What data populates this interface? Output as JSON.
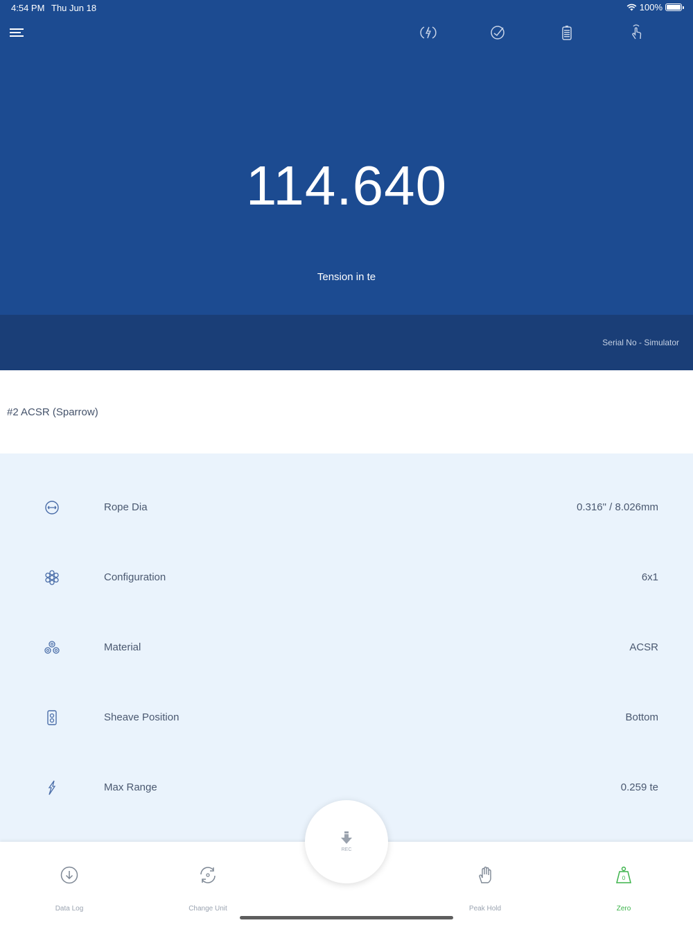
{
  "status_bar": {
    "time": "4:54 PM",
    "date": "Thu Jun 18",
    "battery": "100%"
  },
  "toolbar": {
    "icons": [
      "menu-icon",
      "power-icon",
      "calibration-icon",
      "battery-icon",
      "touch-icon"
    ]
  },
  "reading": {
    "value": "114.640",
    "label": "Tension in te"
  },
  "device": {
    "serial": "Serial No - Simulator"
  },
  "product": {
    "name": "#2 ACSR (Sparrow)"
  },
  "details": [
    {
      "icon": "rope-dia-icon",
      "label": "Rope Dia",
      "value": "0.316\" / 8.026mm"
    },
    {
      "icon": "configuration-icon",
      "label": "Configuration",
      "value": "6x1"
    },
    {
      "icon": "material-icon",
      "label": "Material",
      "value": "ACSR"
    },
    {
      "icon": "sheave-position-icon",
      "label": "Sheave Position",
      "value": "Bottom"
    },
    {
      "icon": "max-range-icon",
      "label": "Max Range",
      "value": "0.259 te"
    }
  ],
  "record": {
    "label": "REC"
  },
  "tabs": [
    {
      "icon": "data-log-icon",
      "label": "Data Log"
    },
    {
      "icon": "change-unit-icon",
      "label": "Change Unit"
    },
    {
      "icon": "peak-hold-icon",
      "label": "Peak Hold"
    },
    {
      "icon": "zero-icon",
      "label": "Zero",
      "active": true
    }
  ],
  "colors": {
    "header_blue": "#1c4b91",
    "serial_bar": "#1a3e77",
    "details_bg": "#eaf3fc",
    "active_green": "#3bb34a"
  }
}
